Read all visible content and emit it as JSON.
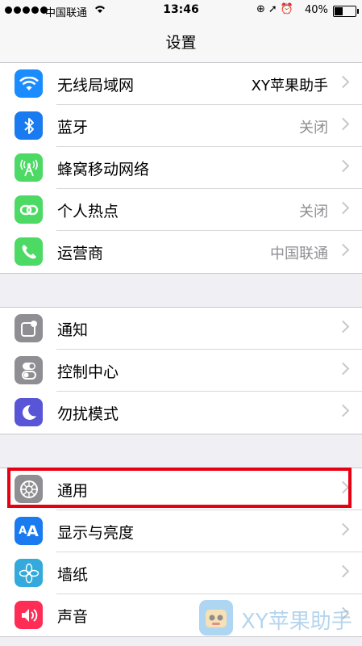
{
  "status_bar": {
    "carrier": "中国联通",
    "time": "13:46",
    "battery": "40%",
    "battery_level": 0.4
  },
  "nav": {
    "title": "设置"
  },
  "groups": [
    {
      "rows": [
        {
          "label": "无线局域网",
          "value": "XY苹果助手",
          "icon": "wifi-icon",
          "color": "#1a8cff"
        },
        {
          "label": "蓝牙",
          "value": "关闭",
          "icon": "bluetooth-icon",
          "color": "#1a7bf0"
        },
        {
          "label": "蜂窝移动网络",
          "value": "",
          "icon": "cellular-antenna-icon",
          "color": "#4cd964"
        },
        {
          "label": "个人热点",
          "value": "关闭",
          "icon": "hotspot-link-icon",
          "color": "#4cd964"
        },
        {
          "label": "运营商",
          "value": "中国联通",
          "icon": "phone-icon",
          "color": "#4cd964"
        }
      ]
    },
    {
      "rows": [
        {
          "label": "通知",
          "icon": "notifications-icon",
          "color": "#8e8e93"
        },
        {
          "label": "控制中心",
          "icon": "control-center-toggles-icon",
          "color": "#8e8e93"
        },
        {
          "label": "勿扰模式",
          "icon": "moon-icon",
          "color": "#5856d6"
        }
      ]
    },
    {
      "rows": [
        {
          "label": "通用",
          "icon": "gear-icon",
          "color": "#8e8e93"
        },
        {
          "label": "显示与亮度",
          "icon": "text-size-icon",
          "color": "#1a7bf0"
        },
        {
          "label": "墙纸",
          "icon": "flower-icon",
          "color": "#34aadc"
        },
        {
          "label": "声音",
          "icon": "speaker-icon",
          "color": "#ff2d55"
        }
      ]
    }
  ],
  "highlight_color": "#e60012",
  "watermark": {
    "text": "XY苹果助手",
    "icon": "xy-logo-icon"
  }
}
